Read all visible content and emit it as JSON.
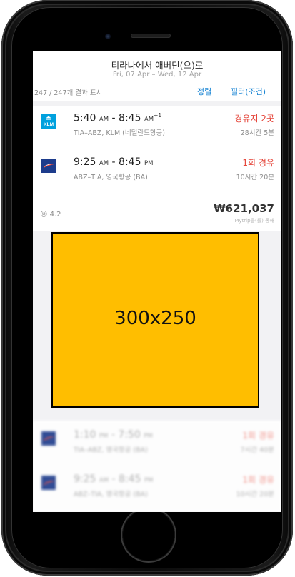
{
  "header": {
    "title": "티라나에서 애버딘(으)로",
    "dates": "Fri, 07 Apr – Wed, 12 Apr",
    "result_count": "247 / 247개 결과 표시",
    "sort_label": "정렬",
    "filter_label": "필터(조건)"
  },
  "result1": {
    "outbound": {
      "depart": "5:40",
      "depart_period": "AM",
      "arrive": "8:45",
      "arrive_period": "AM",
      "day_offset": "+1",
      "route": "TIA–ABZ, KLM (네덜란드항공)",
      "stops": "경유지 2곳",
      "duration": "28시간 5분",
      "logo_icon": "klm-logo-icon"
    },
    "inbound": {
      "depart": "9:25",
      "depart_period": "AM",
      "arrive": "8:45",
      "arrive_period": "PM",
      "route": "ABZ–TIA, 영국항공 (BA)",
      "stops": "1회 경유",
      "duration": "10시간 20분",
      "logo_icon": "british-airways-logo-icon"
    },
    "rating": "4.2",
    "price": "₩621,037",
    "price_note": "Mytrip을(를) 통해"
  },
  "ad": {
    "label": "300x250",
    "color": "#ffbe00"
  },
  "result2": {
    "outbound": {
      "depart": "1:10",
      "depart_period": "PM",
      "arrive": "7:50",
      "arrive_period": "PM",
      "route": "TIA–ABZ, 영국항공 (BA)",
      "stops": "1회 경유",
      "duration": "7시간 40분",
      "logo_icon": "british-airways-logo-icon"
    },
    "inbound": {
      "depart": "9:25",
      "depart_period": "AM",
      "arrive": "8:45",
      "arrive_period": "PM",
      "route": "ABZ–TIA, 영국항공 (BA)",
      "stops": "1회 경유",
      "duration": "10시간 20분",
      "logo_icon": "british-airways-logo-icon"
    }
  },
  "colors": {
    "accent_link": "#1b86d4",
    "stops_red": "#e5453a",
    "klm_blue": "#00a1de",
    "ba_navy": "#1d3c8c"
  }
}
